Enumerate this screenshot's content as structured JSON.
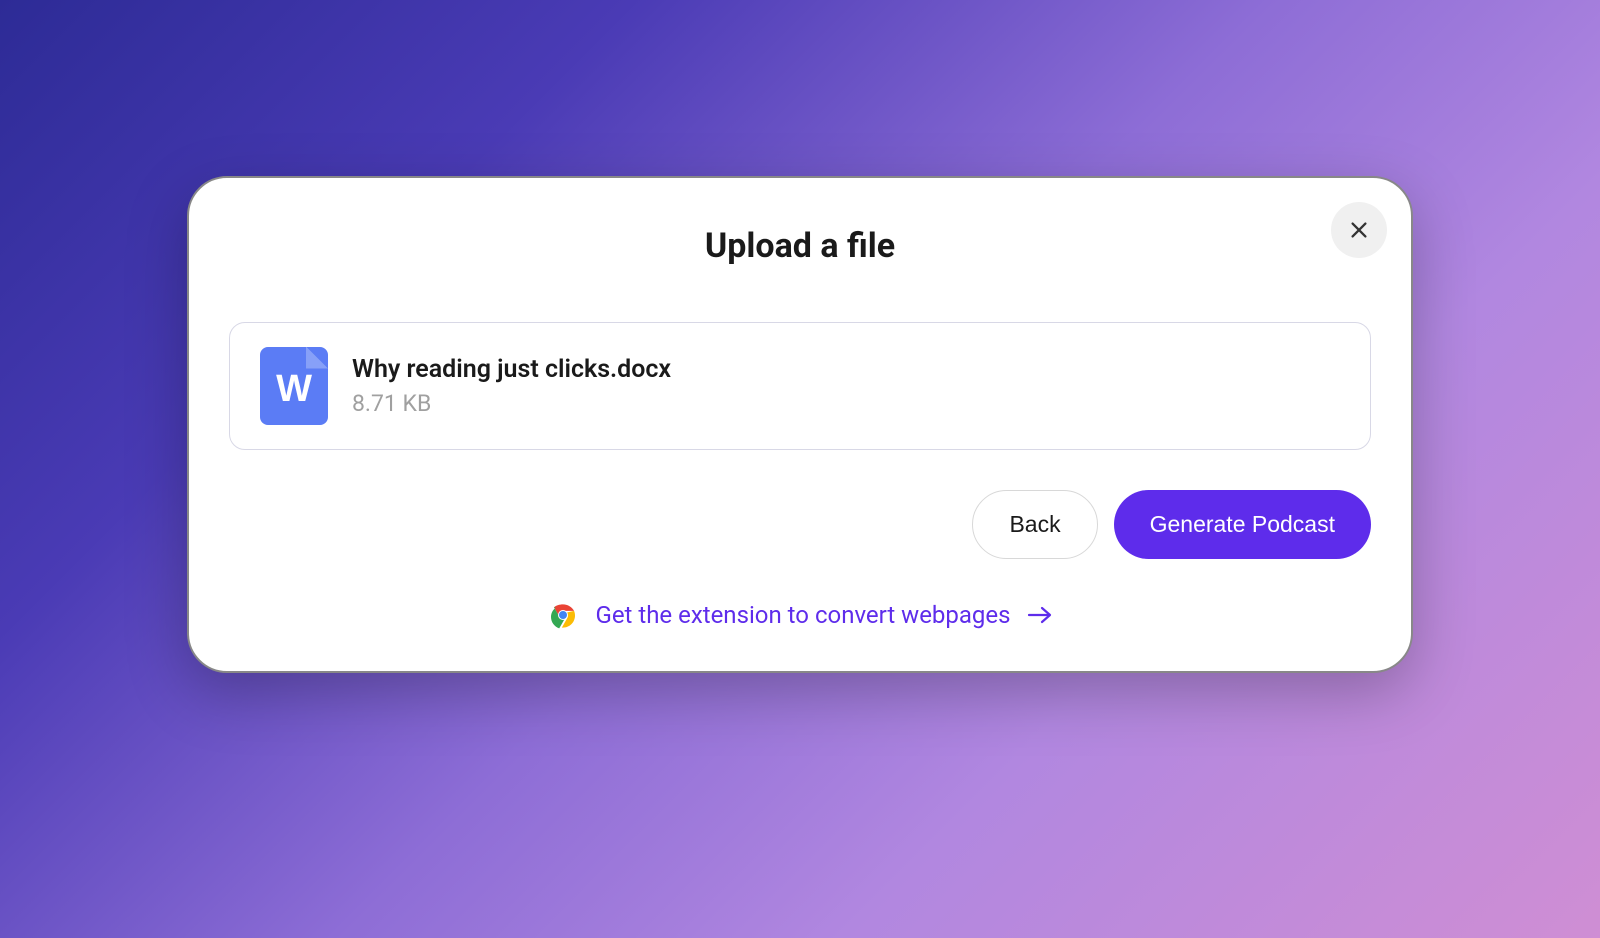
{
  "modal": {
    "title": "Upload a file",
    "file": {
      "name": "Why reading just clicks.docx",
      "size": "8.71 KB",
      "icon_letter": "W"
    },
    "buttons": {
      "back": "Back",
      "generate": "Generate Podcast"
    },
    "extension_link": "Get the extension to convert webpages"
  },
  "colors": {
    "primary": "#5e2ceb",
    "file_icon": "#5b7cf5"
  }
}
